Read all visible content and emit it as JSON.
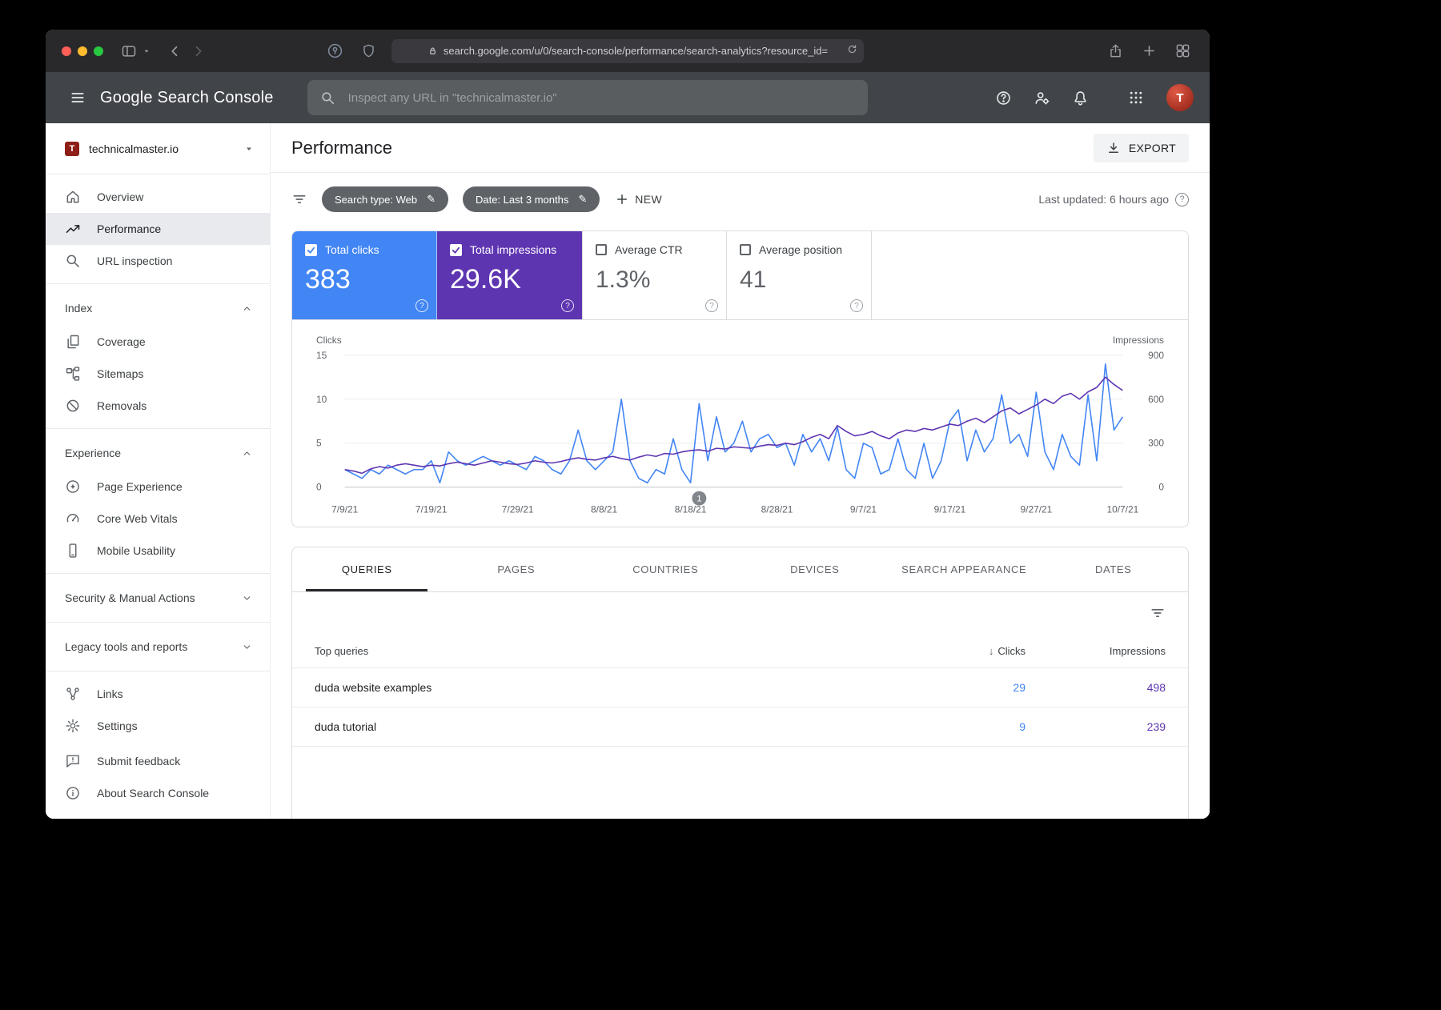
{
  "icons": {
    "question": "?",
    "sort_desc": "↓",
    "edit": "✎"
  },
  "browser": {
    "url": "search.google.com/u/0/search-console/performance/search-analytics?resource_id=",
    "traffic_lights": [
      "#ff5f57",
      "#febc2e",
      "#28c840"
    ]
  },
  "gsc_header": {
    "logo": "Google Search Console",
    "search_placeholder": "Inspect any URL in \"technicalmaster.io\""
  },
  "sidebar": {
    "property": "technicalmaster.io",
    "nav": [
      {
        "label": "Overview"
      },
      {
        "label": "Performance"
      },
      {
        "label": "URL inspection"
      }
    ],
    "sections": [
      {
        "label": "Index",
        "expanded": true,
        "items": [
          "Coverage",
          "Sitemaps",
          "Removals"
        ]
      },
      {
        "label": "Experience",
        "expanded": true,
        "items": [
          "Page Experience",
          "Core Web Vitals",
          "Mobile Usability"
        ]
      },
      {
        "label": "Security & Manual Actions",
        "expanded": false,
        "items": []
      },
      {
        "label": "Legacy tools and reports",
        "expanded": false,
        "items": []
      }
    ],
    "tools": [
      "Links",
      "Settings"
    ],
    "footer": [
      "Submit feedback",
      "About Search Console"
    ]
  },
  "page": {
    "title": "Performance",
    "export_label": "EXPORT",
    "chips": [
      {
        "label": "Search type: Web"
      },
      {
        "label": "Date: Last 3 months"
      }
    ],
    "new_label": "NEW",
    "last_updated": "Last updated: 6 hours ago"
  },
  "metrics": [
    {
      "label": "Total clicks",
      "value": "383",
      "checked": true,
      "color": "#4285f4"
    },
    {
      "label": "Total impressions",
      "value": "29.6K",
      "checked": true,
      "color": "#5e35b1"
    },
    {
      "label": "Average CTR",
      "value": "1.3%",
      "checked": false,
      "color": "#ffffff"
    },
    {
      "label": "Average position",
      "value": "41",
      "checked": false,
      "color": "#ffffff"
    }
  ],
  "tabs": {
    "items": [
      "QUERIES",
      "PAGES",
      "COUNTRIES",
      "DEVICES",
      "SEARCH APPEARANCE",
      "DATES"
    ],
    "active": "QUERIES"
  },
  "table": {
    "columns": {
      "queries": "Top queries",
      "clicks": "Clicks",
      "impressions": "Impressions"
    },
    "rows": [
      {
        "query": "duda website examples",
        "clicks": "29",
        "impressions": "498"
      },
      {
        "query": "duda tutorial",
        "clicks": "9",
        "impressions": "239"
      }
    ]
  },
  "chart_data": {
    "type": "line",
    "title": "Performance over time (last 3 months)",
    "x_ticks": [
      "7/9/21",
      "7/19/21",
      "7/29/21",
      "8/8/21",
      "8/18/21",
      "8/28/21",
      "9/7/21",
      "9/17/21",
      "9/27/21",
      "10/7/21"
    ],
    "left_axis": {
      "label": "Clicks",
      "ticks": [
        0,
        5,
        10,
        15
      ],
      "max": 15
    },
    "right_axis": {
      "label": "Impressions",
      "ticks": [
        0,
        300,
        600,
        900
      ],
      "max": 900
    },
    "grid": true,
    "legend_position": "none",
    "annotation": {
      "label": "1",
      "day_index": 41
    },
    "series": [
      {
        "name": "Clicks",
        "axis": "left",
        "color": "#4285f4",
        "values": [
          2,
          1.5,
          1,
          2,
          1.5,
          2.5,
          2,
          1.5,
          2,
          2,
          3,
          0.5,
          4,
          3,
          2.5,
          3,
          3.5,
          3,
          2.5,
          3,
          2.5,
          2,
          3.5,
          3,
          2,
          1.5,
          3,
          6.5,
          3,
          2,
          3,
          4,
          10,
          3,
          1,
          0.5,
          2,
          1.5,
          5.5,
          2,
          0.5,
          9.5,
          3,
          8,
          4,
          5,
          7.5,
          4,
          5.5,
          6,
          4.5,
          5,
          2.5,
          6,
          4,
          5.5,
          3,
          6.8,
          2,
          1,
          5,
          4.5,
          1.5,
          2,
          5.5,
          2,
          1,
          5,
          1,
          3,
          7.5,
          8.8,
          3,
          6.5,
          4,
          5.5,
          10.5,
          5,
          6,
          3.5,
          10.8,
          4,
          2,
          6,
          3.5,
          2.5,
          10.5,
          3,
          14,
          6.5,
          8
        ]
      },
      {
        "name": "Impressions",
        "axis": "right",
        "color": "#5e35b1",
        "values": [
          120,
          110,
          95,
          125,
          140,
          130,
          150,
          160,
          150,
          140,
          150,
          145,
          160,
          170,
          160,
          150,
          165,
          180,
          170,
          160,
          155,
          165,
          180,
          170,
          165,
          175,
          190,
          200,
          190,
          185,
          200,
          210,
          195,
          185,
          205,
          220,
          210,
          230,
          225,
          240,
          250,
          255,
          245,
          265,
          260,
          275,
          270,
          265,
          280,
          290,
          285,
          300,
          290,
          310,
          340,
          360,
          330,
          420,
          380,
          350,
          360,
          380,
          350,
          330,
          370,
          390,
          380,
          400,
          390,
          410,
          430,
          420,
          450,
          470,
          440,
          480,
          520,
          540,
          500,
          530,
          560,
          600,
          570,
          620,
          640,
          600,
          650,
          680,
          750,
          700,
          660
        ]
      }
    ]
  }
}
